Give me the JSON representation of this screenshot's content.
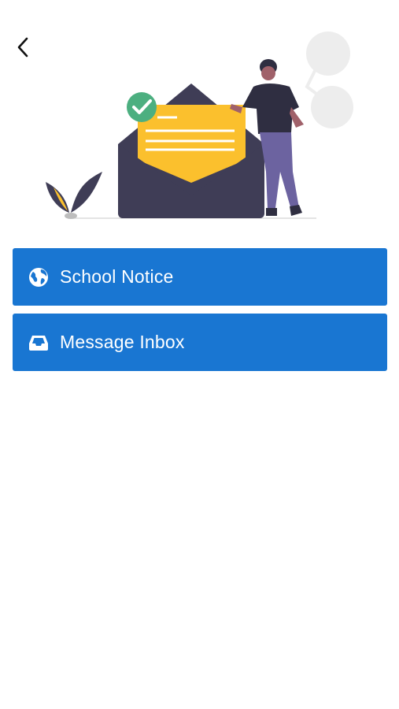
{
  "theme": {
    "accent": "#1976d2",
    "illustration_yellow": "#fbc02d",
    "illustration_dark": "#3f3d56",
    "check_green": "#4caf80"
  },
  "header": {
    "back_icon": "chevron-left-icon"
  },
  "hero": {
    "image": "mail-illustration"
  },
  "menu": {
    "items": [
      {
        "label": "School Notice",
        "icon": "globe-icon"
      },
      {
        "label": "Message Inbox",
        "icon": "inbox-icon"
      }
    ]
  }
}
